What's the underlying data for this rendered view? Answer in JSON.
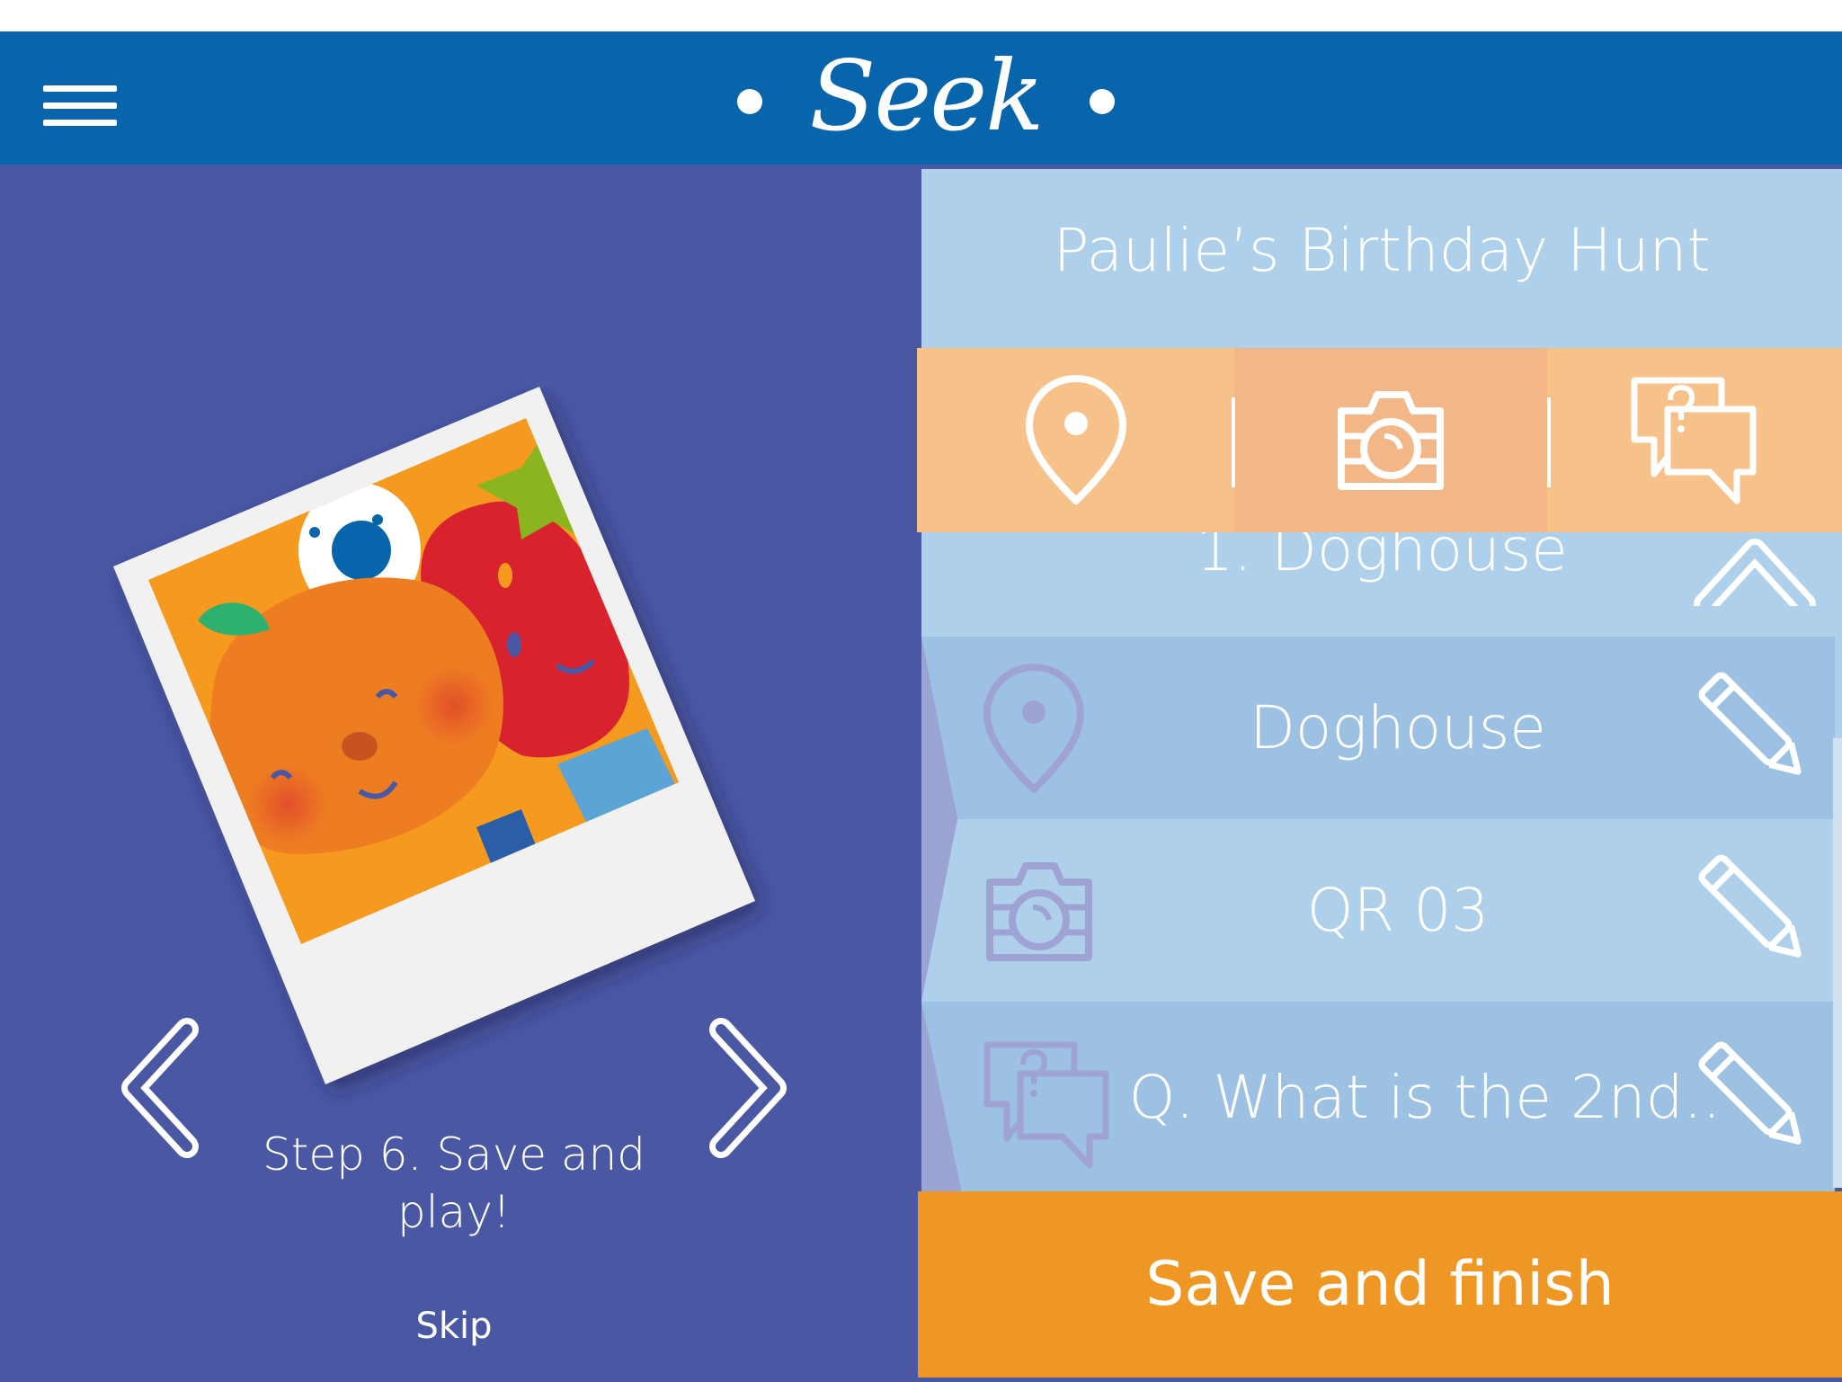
{
  "app": {
    "logo": "Seek"
  },
  "colors": {
    "header_blue": "#0865ab",
    "panel_purple": "#4a58a4",
    "light_blue": "#aed0ea",
    "orange_soft": "#f6c289",
    "orange_button": "#ef9725"
  },
  "tutorial": {
    "step_text": "Step 6. Save and play!",
    "skip_label": "Skip",
    "prev_icon": "chevron-left-icon",
    "next_icon": "chevron-right-icon"
  },
  "hunt": {
    "title": "Paulie’s Birthday Hunt",
    "toolbar": [
      {
        "icon": "location-pin-icon"
      },
      {
        "icon": "camera-icon"
      },
      {
        "icon": "question-chat-icon"
      }
    ],
    "section": {
      "title": "1. Doghouse",
      "collapse_icon": "chevron-up-icon"
    },
    "items": [
      {
        "icon": "location-pin-icon",
        "label": "Doghouse",
        "edit_icon": "pencil-icon"
      },
      {
        "icon": "camera-icon",
        "label": "QR 03",
        "edit_icon": "pencil-icon"
      },
      {
        "icon": "question-chat-icon",
        "label": "Q. What is the 2nd..",
        "edit_icon": "pencil-icon"
      }
    ],
    "save_label": "Save and finish"
  }
}
